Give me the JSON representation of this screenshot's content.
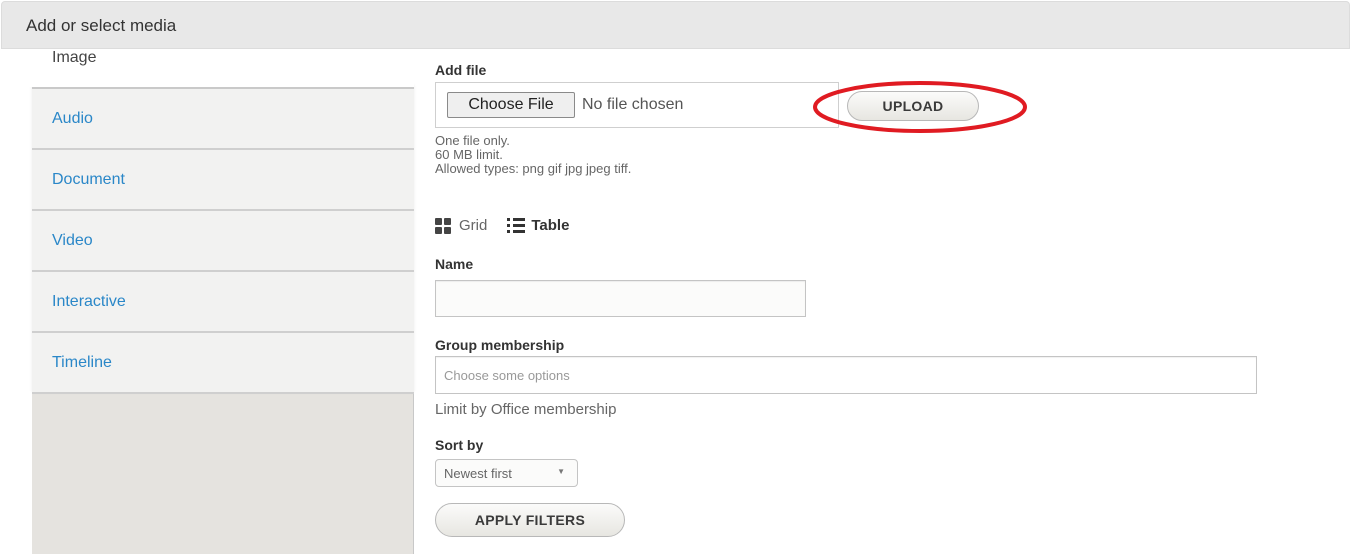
{
  "dialog": {
    "title": "Add or select media"
  },
  "sidebar": {
    "active_tab": "Image",
    "tabs": [
      {
        "label": "Audio"
      },
      {
        "label": "Document"
      },
      {
        "label": "Video"
      },
      {
        "label": "Interactive"
      },
      {
        "label": "Timeline"
      }
    ],
    "link_color": "#2a87c8"
  },
  "add_file": {
    "label": "Add file",
    "choose_button": "Choose File",
    "status": "No file chosen",
    "upload_button": "UPLOAD",
    "help_lines": [
      "One file only.",
      "60 MB limit.",
      "Allowed types: png gif jpg jpeg tiff."
    ],
    "annotation_color": "#e01b22"
  },
  "view_toggle": {
    "grid_label": "Grid",
    "table_label": "Table"
  },
  "filters": {
    "name_label": "Name",
    "name_value": "",
    "group_label": "Group membership",
    "group_placeholder": "Choose some options",
    "group_description": "Limit by Office membership",
    "sort_label": "Sort by",
    "sort_value": "Newest first",
    "apply_button": "APPLY FILTERS"
  }
}
